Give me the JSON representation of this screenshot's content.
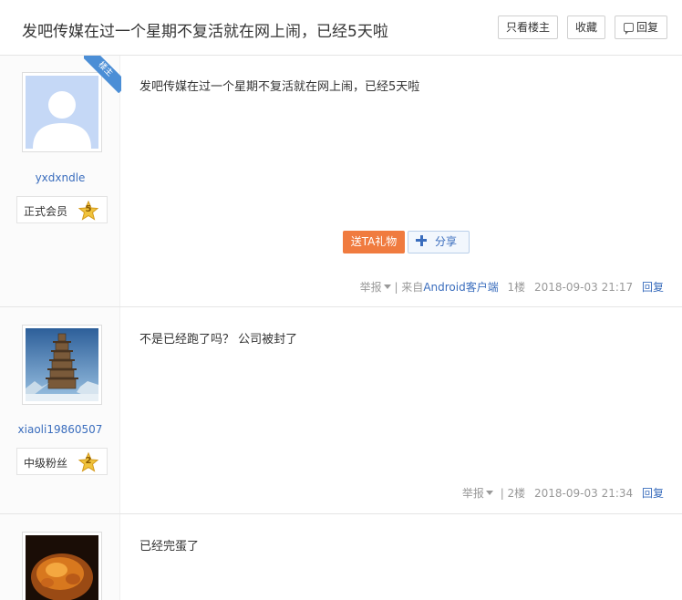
{
  "thread": {
    "title": "发吧传媒在过一个星期不复活就在网上闹，已经5天啦",
    "actions": {
      "only_op": "只看楼主",
      "favorite": "收藏",
      "reply": "回复"
    }
  },
  "posts": [
    {
      "username": "yxdxndle",
      "rank": "正式会员",
      "level": "5",
      "op_badge": "楼主",
      "avatar": "default-avatar",
      "content": "发吧传媒在过一个星期不复活就在网上闹，已经5天啦",
      "gift_label": "送TA礼物",
      "share_label": "分享",
      "report": "举报",
      "source_prefix": "| 来自",
      "source": "Android客户端",
      "floor": "1楼",
      "time": "2018-09-03 21:17",
      "reply": "回复"
    },
    {
      "username": "xiaoli19860507",
      "rank": "中级粉丝",
      "level": "2",
      "avatar": "pagoda-photo",
      "content": "不是已经跑了吗？ 公司被封了",
      "report": "举报",
      "floor": "| 2楼",
      "time": "2018-09-03 21:34",
      "reply": "回复"
    },
    {
      "avatar": "amber-carving-photo",
      "content": "已经完蛋了"
    }
  ],
  "colors": {
    "link": "#3a6dbd",
    "gift": "#f07b3f",
    "op_badge": "#4b8ed6",
    "level_star": "#f0c33c"
  }
}
